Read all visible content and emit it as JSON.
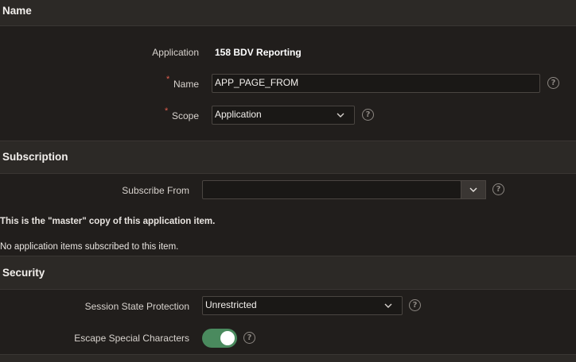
{
  "name_section": {
    "title": "Name",
    "application_label": "Application",
    "application_value": "158 BDV Reporting",
    "name_label": "Name",
    "name_value": "APP_PAGE_FROM",
    "scope_label": "Scope",
    "scope_value": "Application",
    "required_marker": "*"
  },
  "subscription_section": {
    "title": "Subscription",
    "subscribe_from_label": "Subscribe From",
    "subscribe_from_value": "",
    "master_note": "This is the \"master\" copy of this application item.",
    "no_items_note": "No application items subscribed to this item."
  },
  "security_section": {
    "title": "Security",
    "session_state_label": "Session State Protection",
    "session_state_value": "Unrestricted",
    "escape_label": "Escape Special Characters",
    "escape_enabled": true
  },
  "icons": {
    "help": "help-icon",
    "chevron": "chevron-down-icon"
  },
  "colors": {
    "toggle_on": "#4a8a5e",
    "required": "#e05e4e",
    "background": "#211e1c",
    "section_header": "#2c2926"
  },
  "help_glyph": "?"
}
